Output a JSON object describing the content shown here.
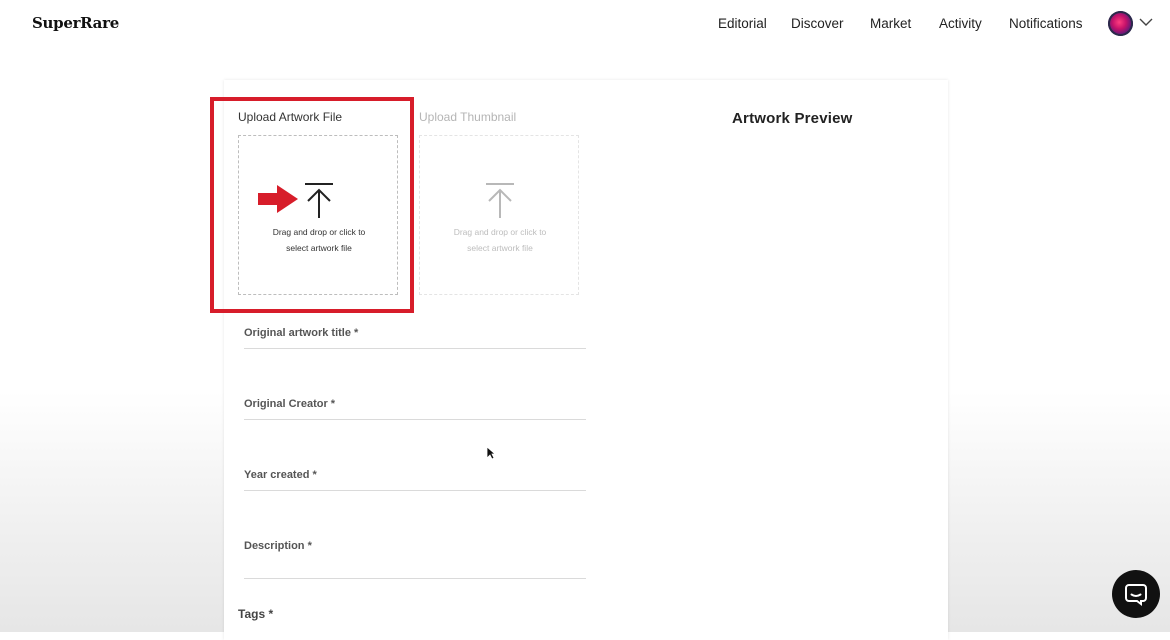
{
  "header": {
    "logo": "SuperRare",
    "nav": [
      {
        "label": "Editorial"
      },
      {
        "label": "Discover"
      },
      {
        "label": "Market"
      },
      {
        "label": "Activity"
      },
      {
        "label": "Notifications"
      }
    ],
    "avatar_icon": "user-avatar",
    "dropdown_icon": "chevron-down-icon"
  },
  "upload": {
    "artwork": {
      "label": "Upload Artwork File",
      "hint": "Drag and drop or click to\nselect artwork file",
      "icon": "upload-icon"
    },
    "thumbnail": {
      "label": "Upload Thumbnail",
      "hint": "Drag and drop or click to\nselect artwork file",
      "icon": "upload-icon"
    }
  },
  "preview": {
    "title": "Artwork Preview"
  },
  "form": {
    "fields": [
      {
        "label": "Original artwork title *"
      },
      {
        "label": "Original Creator *"
      },
      {
        "label": "Year created *"
      },
      {
        "label": "Description *"
      }
    ],
    "tags_label": "Tags *"
  },
  "annotation": {
    "highlight_color": "#d71d2a",
    "arrow_icon": "arrow-right-icon"
  },
  "chat": {
    "icon": "chat-icon"
  },
  "colors": {
    "text": "#111111",
    "muted": "#555555",
    "faded": "#b5b5b5",
    "accent_red": "#d71d2a"
  }
}
